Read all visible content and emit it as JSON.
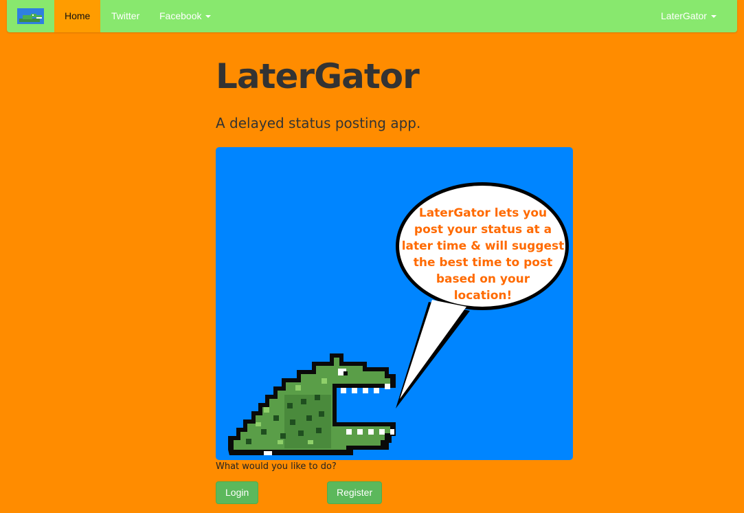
{
  "navbar": {
    "brand_icon": "gator-logo-icon",
    "items": [
      {
        "label": "Home",
        "active": true
      },
      {
        "label": "Twitter"
      },
      {
        "label": "Facebook",
        "dropdown": true
      }
    ],
    "user_menu": {
      "label": "LaterGator",
      "dropdown": true
    },
    "colors": {
      "background": "#88e86e",
      "active": "#ff9c00"
    }
  },
  "page": {
    "title": "LaterGator",
    "subtitle": "A delayed status posting app.",
    "background_color": "#ff8c00"
  },
  "hero": {
    "background_color": "#0085ff",
    "speech_bubble_lines": [
      "LaterGator lets you",
      "post your status at a",
      "later time & will suggest",
      "the best time to post",
      "based on your",
      "location!"
    ],
    "illustration": "pixel-alligator-icon"
  },
  "actions": {
    "prompt": "What would you like to do?",
    "login_label": "Login",
    "register_label": "Register"
  }
}
